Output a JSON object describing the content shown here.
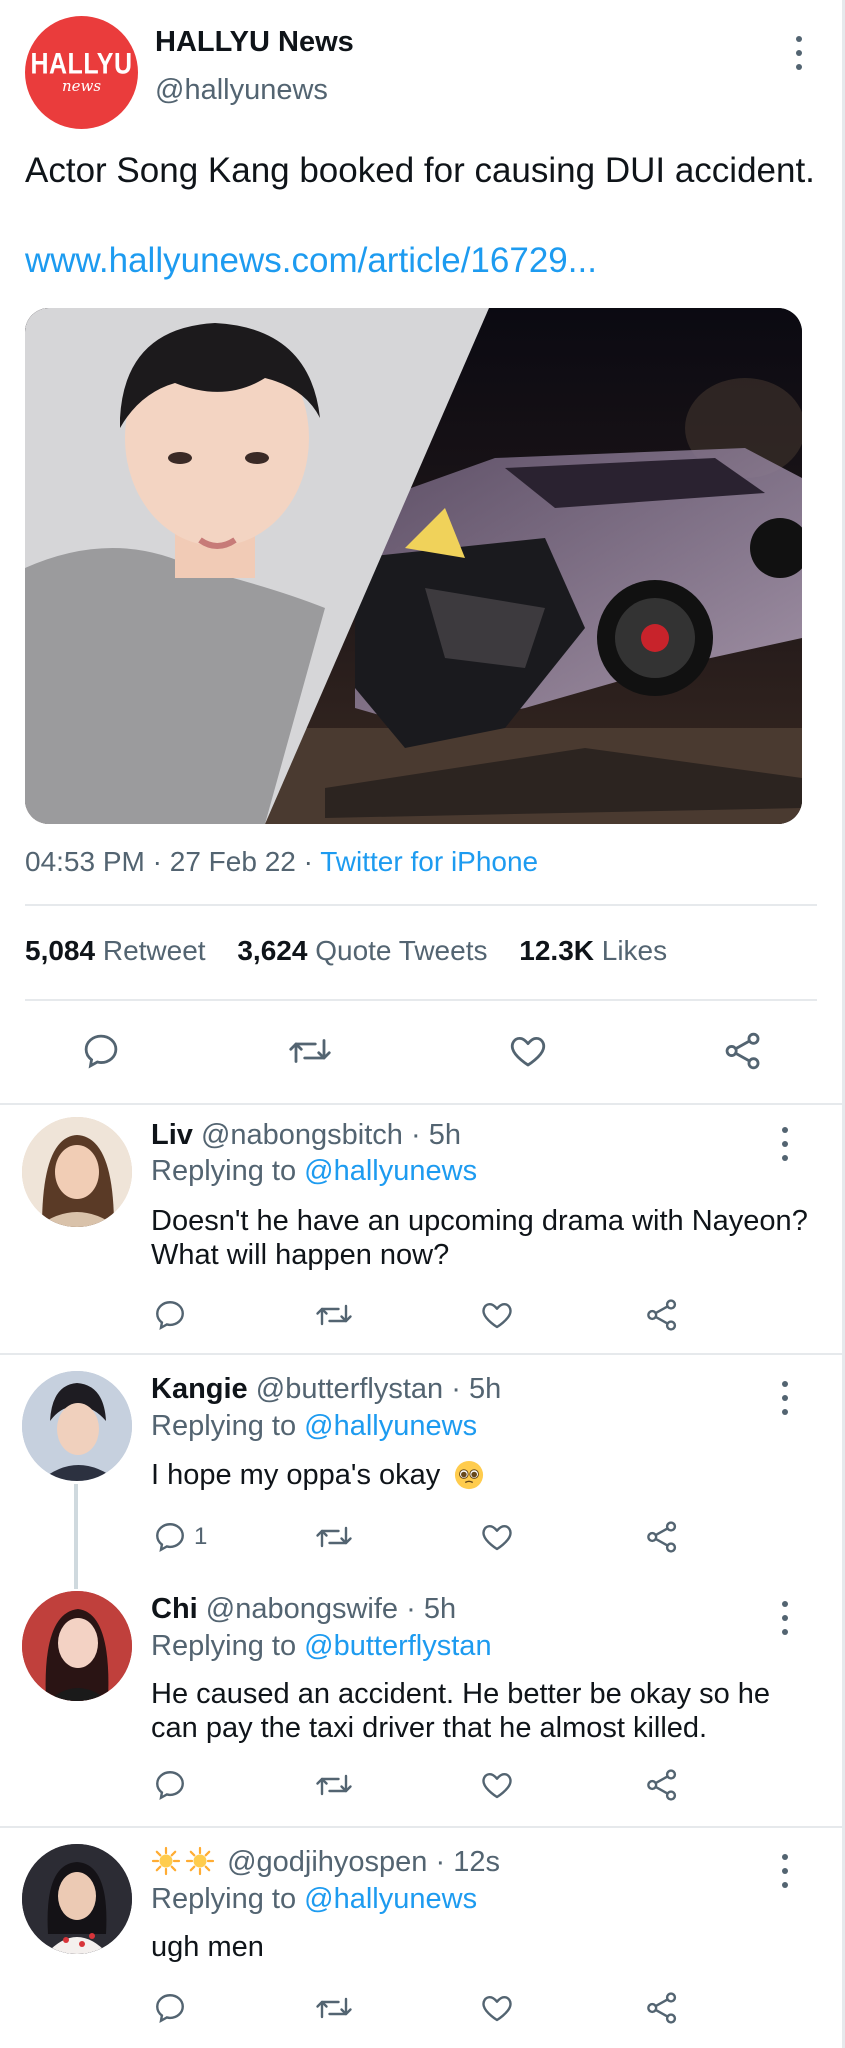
{
  "main_tweet": {
    "display_name": "HALLYU News",
    "handle": "@hallyunews",
    "logo_line1": "HALLYU",
    "logo_line2": "news",
    "text": "Actor Song Kang booked for causing DUI accident.",
    "link": "www.hallyunews.com/article/16729...",
    "time": "04:53 PM",
    "date": "27 Feb 22",
    "source": "Twitter for iPhone",
    "stats": {
      "retweets_count": "5,084",
      "retweets_label": "Retweet",
      "quotes_count": "3,624",
      "quotes_label": "Quote Tweets",
      "likes_count": "12.3K",
      "likes_label": "Likes"
    },
    "media_icons": [
      "portrait-photo",
      "crashed-car-photo"
    ]
  },
  "separator": "·",
  "action_icons": [
    "reply-icon",
    "retweet-icon",
    "like-icon",
    "share-icon"
  ],
  "replies": [
    {
      "name": "Liv",
      "handle": "@nabongsbitch",
      "time": "5h",
      "replying_label": "Replying to",
      "replying_to": "@hallyunews",
      "text": "Doesn't he have an upcoming drama with Nayeon? What will happen now?",
      "reply_count": ""
    },
    {
      "name": "Kangie",
      "handle": "@butterflystan",
      "time": "5h",
      "replying_label": "Replying to",
      "replying_to": "@hallyunews",
      "text": "I hope my oppa's okay",
      "emoji": "pleading-face-emoji",
      "reply_count": "1"
    },
    {
      "name": "Chi",
      "handle": "@nabongswife",
      "time": "5h",
      "replying_label": "Replying to",
      "replying_to": "@butterflystan",
      "text": "He caused an accident. He better be okay so he can pay the taxi driver that he almost killed.",
      "reply_count": ""
    },
    {
      "name_icons": [
        "sun-emoji",
        "sun-emoji"
      ],
      "handle": "@godjihyospen",
      "time": "12s",
      "replying_label": "Replying to",
      "replying_to": "@hallyunews",
      "text": "ugh men",
      "reply_count": ""
    }
  ],
  "colors": {
    "accent": "#1d9bf0",
    "text": "#0f1419",
    "secondary": "#536471",
    "divider": "#e6e9ec",
    "logo_bg": "#ea3c3c"
  }
}
